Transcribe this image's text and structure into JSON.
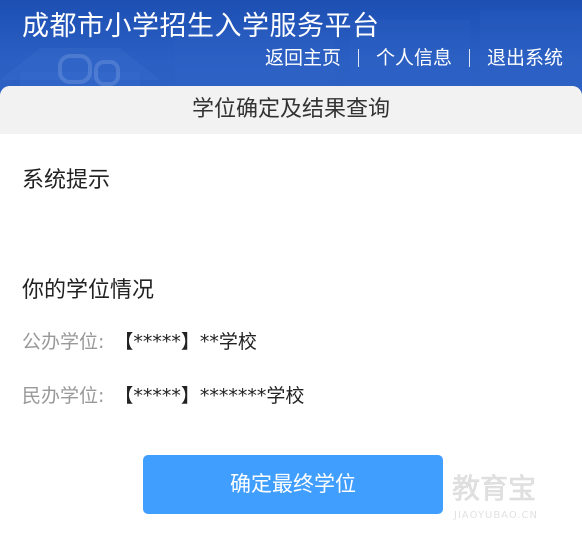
{
  "header": {
    "site_title": "成都市小学招生入学服务平台",
    "nav": {
      "home": "返回主页",
      "profile": "个人信息",
      "logout": "退出系统"
    }
  },
  "card": {
    "title": "学位确定及结果查询",
    "notice_title": "系统提示",
    "status_title": "你的学位情况",
    "rows": [
      {
        "label": "公办学位:",
        "value": "【*****】**学校"
      },
      {
        "label": "民办学位:",
        "value": "【*****】*******学校"
      }
    ],
    "confirm_button": "确定最终学位"
  },
  "watermark": {
    "brand_cn": "教育宝",
    "brand_en": "JIAOYUBAO.CN"
  },
  "colors": {
    "header_blue": "#1d4fb3",
    "button_blue": "#409eff",
    "card_head_bg": "#f2f2f2",
    "label_gray": "#999999"
  }
}
